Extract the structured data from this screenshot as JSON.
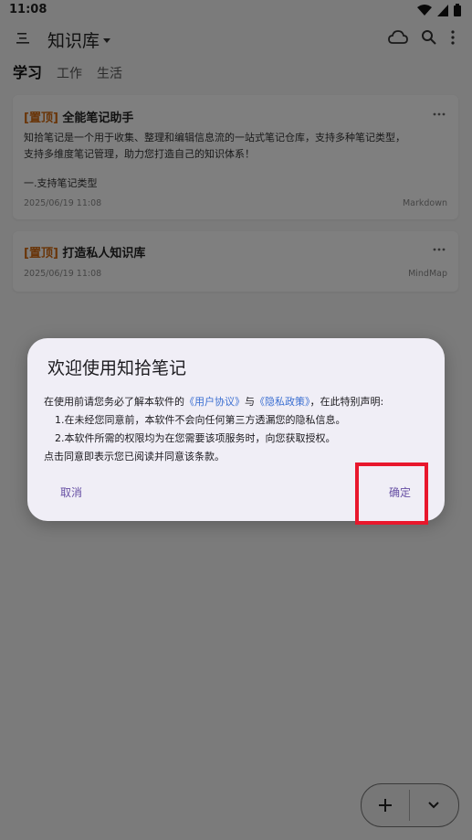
{
  "status_bar": {
    "time": "11:08",
    "icons": [
      "wifi-icon",
      "signal-icon",
      "battery-icon"
    ]
  },
  "app_bar": {
    "title": "知识库",
    "actions": [
      "cloud-icon",
      "search-icon",
      "more-vert-icon"
    ]
  },
  "tabs": [
    {
      "label": "学习",
      "active": true
    },
    {
      "label": "工作",
      "active": false
    },
    {
      "label": "生活",
      "active": false
    }
  ],
  "notes": [
    {
      "pin": "[置顶]",
      "title": "全能笔记助手",
      "body_lines": [
        "知拾笔记是一个用于收集、整理和编辑信息流的一站式笔记仓库，支持多种笔记类型，",
        "支持多维度笔记管理，助力您打造自己的知识体系！",
        "",
        "一.支持笔记类型"
      ],
      "date": "2025/06/19 11:08",
      "type": "Markdown"
    },
    {
      "pin": "[置顶]",
      "title": "打造私人知识库",
      "date": "2025/06/19 11:08",
      "type": "MindMap"
    }
  ],
  "dialog": {
    "title": "欢迎使用知拾笔记",
    "intro_before": "在使用前请您务必了解本软件的",
    "link_agreement": "《用户协议》",
    "and": "与",
    "link_privacy": "《隐私政策》",
    "intro_after": "，在此特别声明:",
    "item1": "1.在未经您同意前，本软件不会向任何第三方透漏您的隐私信息。",
    "item2": "2.本软件所需的权限均为在您需要该项服务时，向您获取授权。",
    "footer": "点击同意即表示您已阅读并同意该条款。",
    "cancel": "取消",
    "confirm": "确定"
  },
  "colors": {
    "pin": "#d2690f",
    "link": "#3b6fd1",
    "dialog_button": "#6750a4",
    "highlight": "#e8172c"
  }
}
